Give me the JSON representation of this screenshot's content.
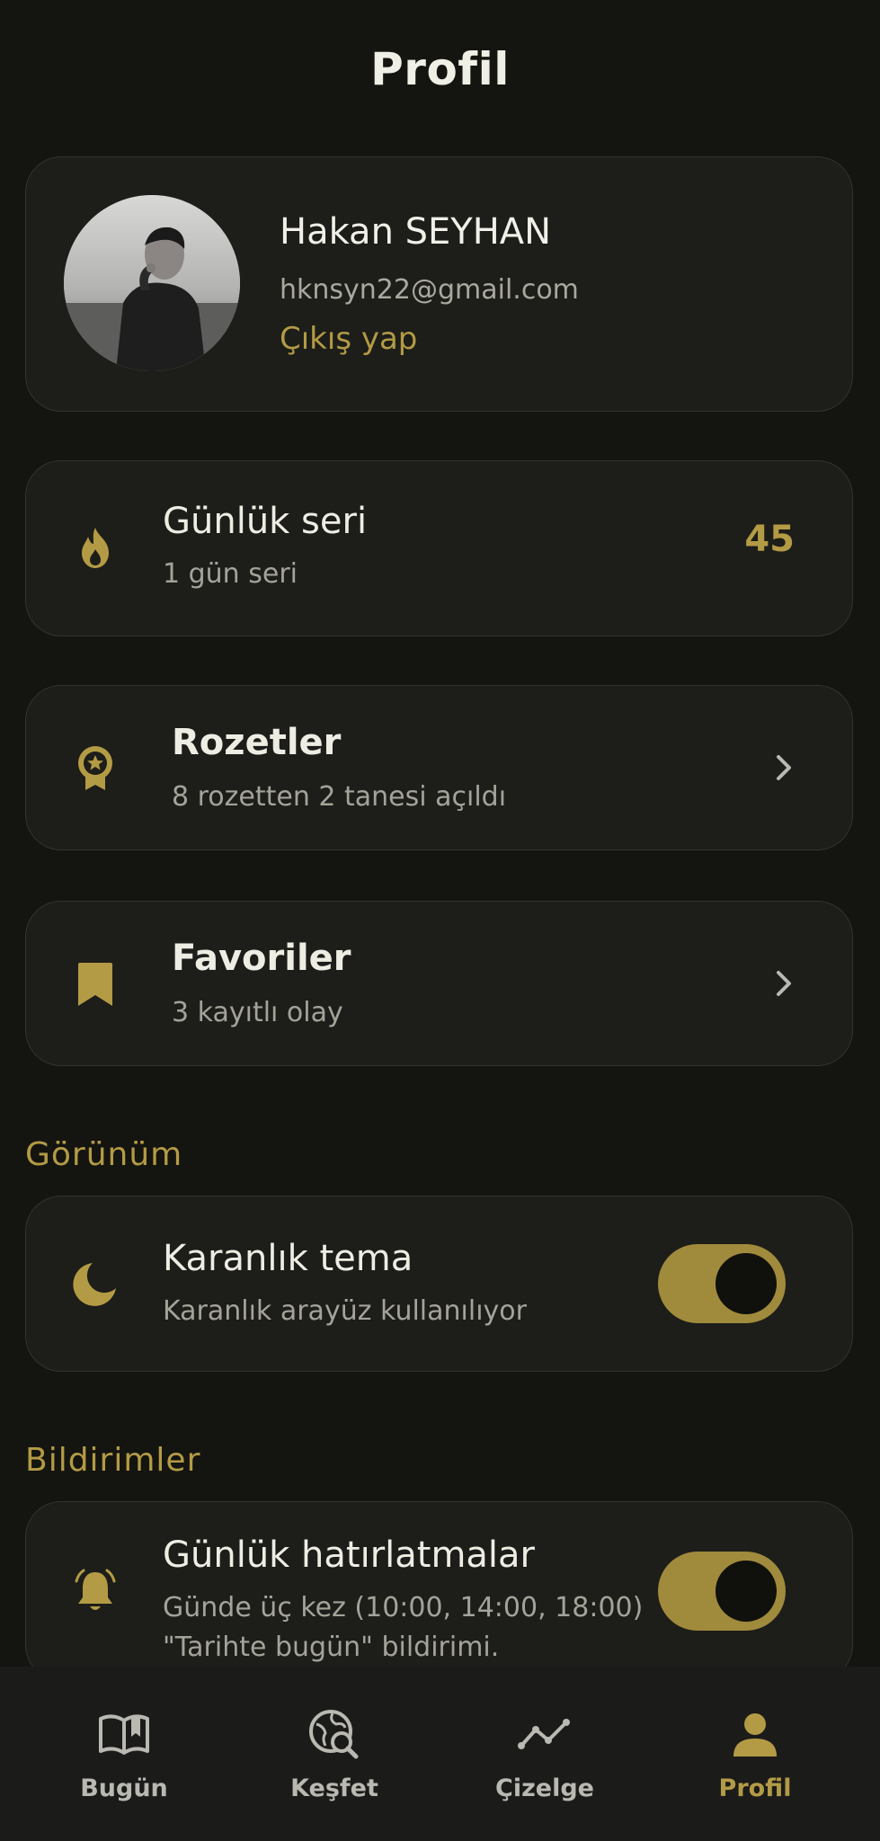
{
  "page": {
    "title": "Profil"
  },
  "profile": {
    "name": "Hakan SEYHAN",
    "email": "hknsyn22@gmail.com",
    "logout_label": "Çıkış yap"
  },
  "streak": {
    "title": "Günlük seri",
    "subtitle": "1 gün seri",
    "value": "45",
    "icon": "flame-icon"
  },
  "badges": {
    "title": "Rozetler",
    "subtitle": "8 rozetten 2 tanesi açıldı",
    "icon": "award-icon"
  },
  "favorites": {
    "title": "Favoriler",
    "subtitle": "3 kayıtlı olay",
    "icon": "bookmark-icon"
  },
  "appearance": {
    "section_label": "Görünüm",
    "dark_theme": {
      "title": "Karanlık tema",
      "subtitle": "Karanlık arayüz kullanılıyor",
      "enabled": true,
      "icon": "moon-icon"
    }
  },
  "notifications": {
    "section_label": "Bildirimler",
    "daily_reminders": {
      "title": "Günlük hatırlatmalar",
      "subtitle": "Günde üç kez (10:00, 14:00, 18:00) \"Tarihte bugün\" bildirimi.",
      "enabled": true,
      "icon": "bell-icon"
    }
  },
  "nav": {
    "items": [
      {
        "label": "Bugün",
        "icon": "open-book-icon",
        "active": false
      },
      {
        "label": "Keşfet",
        "icon": "globe-search-icon",
        "active": false
      },
      {
        "label": "Çizelge",
        "icon": "line-chart-icon",
        "active": false
      },
      {
        "label": "Profil",
        "icon": "person-icon",
        "active": true
      }
    ]
  },
  "colors": {
    "accent": "#b39b45",
    "background": "#141410",
    "card": "#1d1d19",
    "nav_bg": "#1b1b1a"
  }
}
